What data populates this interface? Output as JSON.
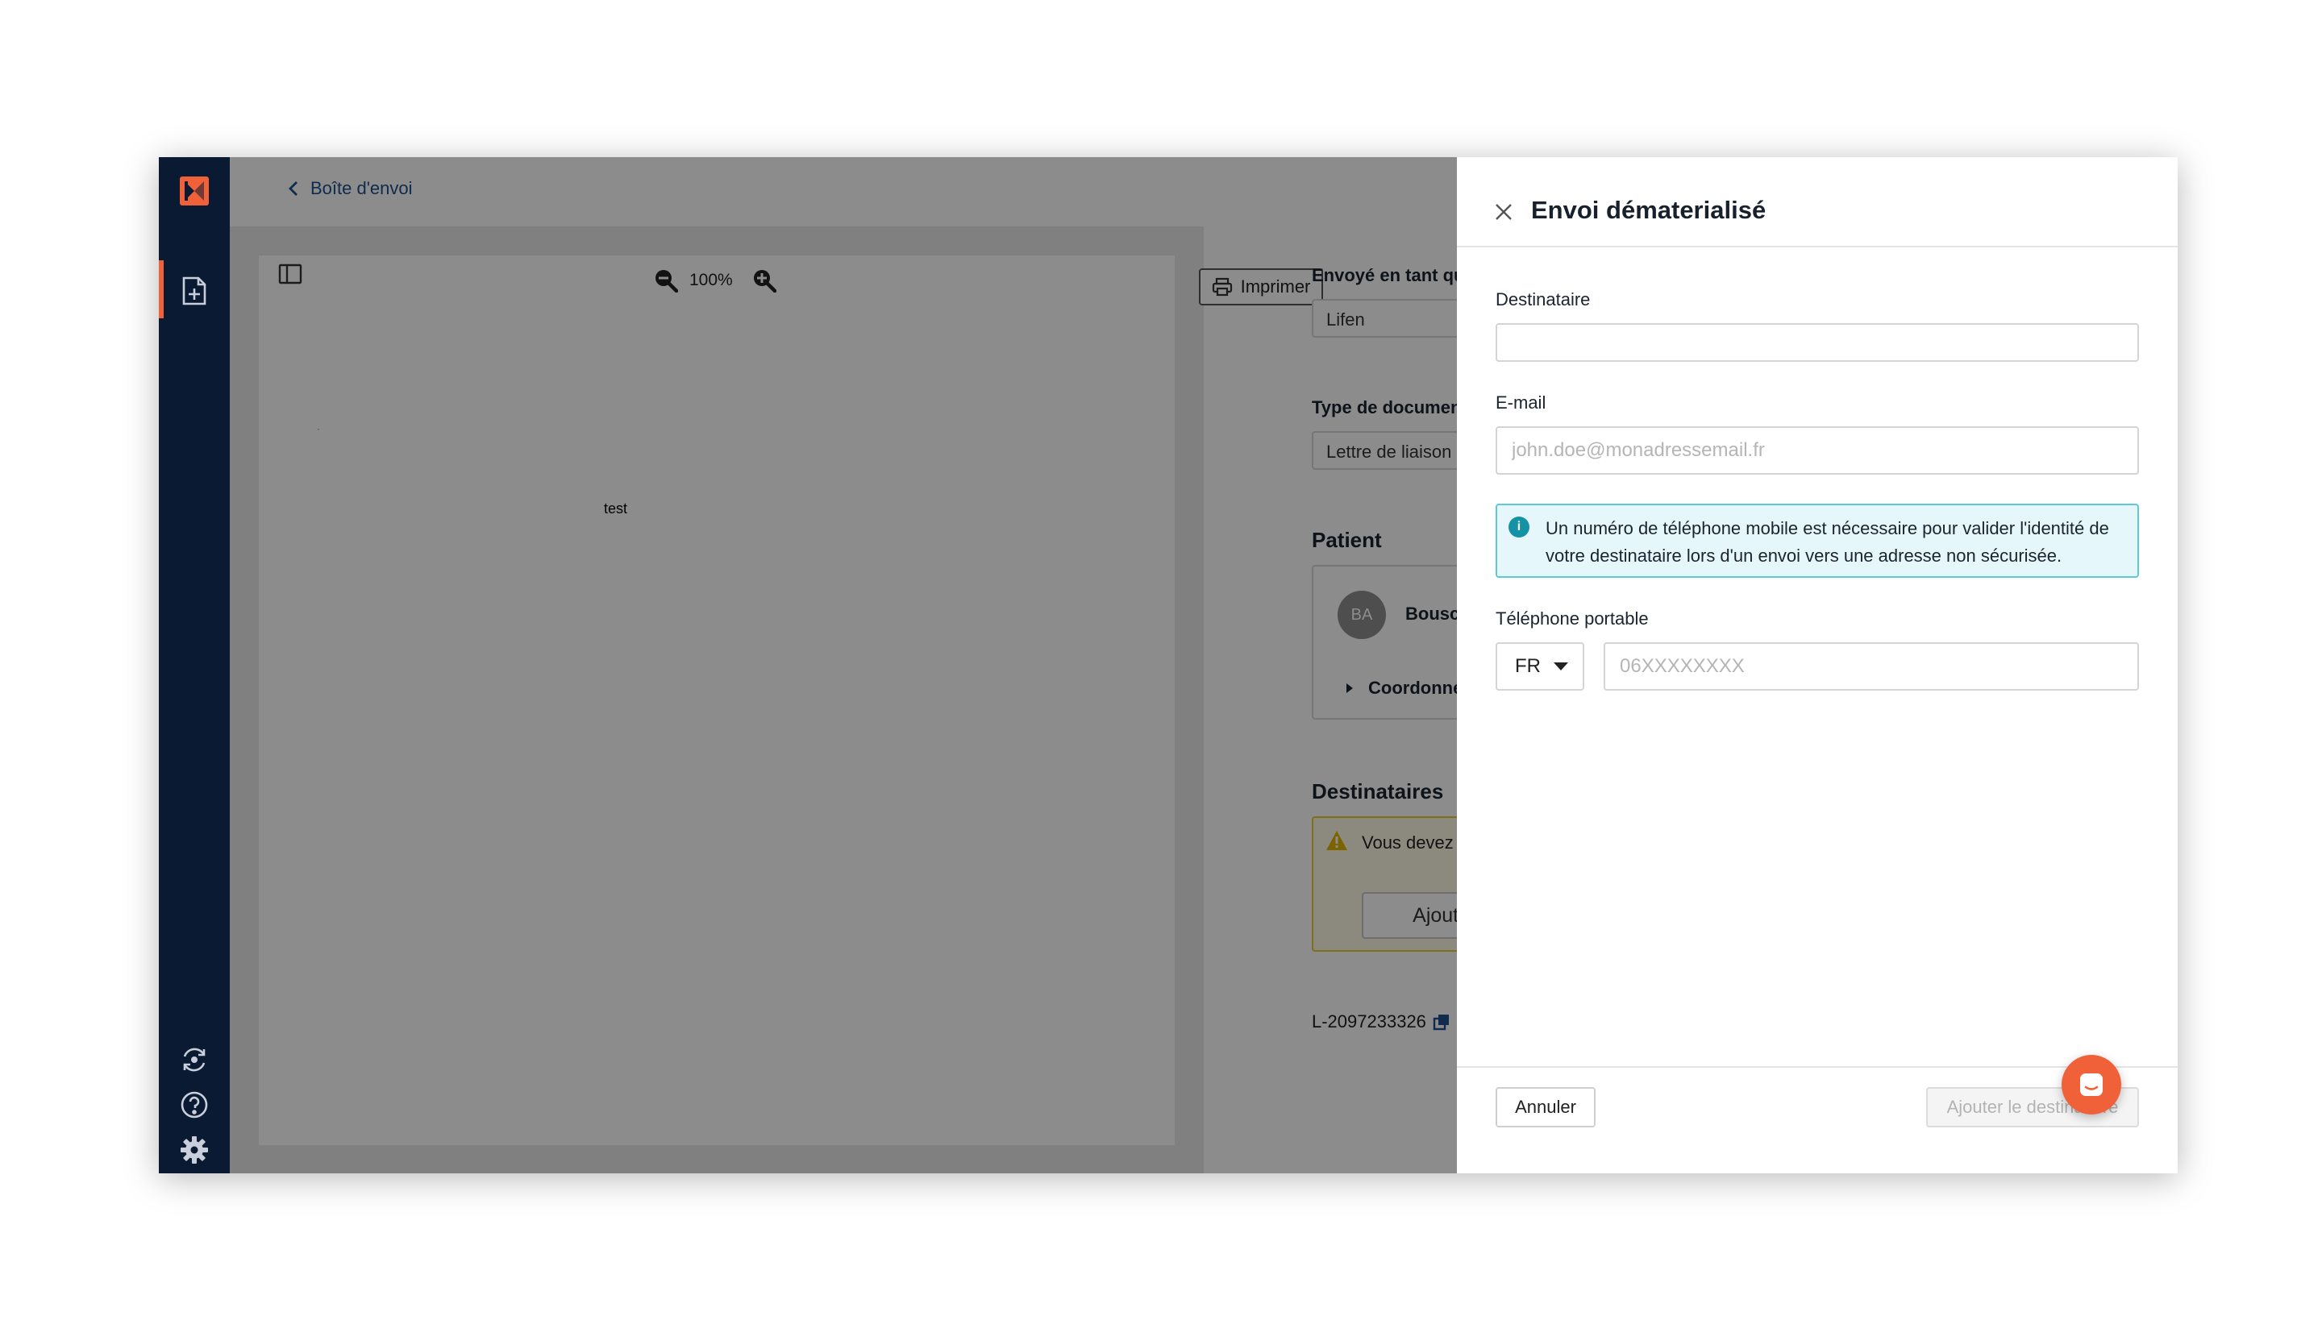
{
  "colors": {
    "sidebar_bg": "#0a1a33",
    "brand": "#f0613a",
    "link": "#1e4f8f",
    "info_bg": "#e5f7fa",
    "info_border": "#5ec8d8",
    "warning_border": "#e7c830"
  },
  "sidebar": {
    "items": [
      {
        "icon": "new-document-icon"
      },
      {
        "icon": "sync-icon"
      },
      {
        "icon": "help-icon"
      },
      {
        "icon": "gear-icon"
      }
    ]
  },
  "header": {
    "back_label": "Boîte d'envoi"
  },
  "viewer": {
    "zoom": "100%",
    "print_label": "Imprimer",
    "document_text": "test",
    "dot": "·"
  },
  "details": {
    "sent_as_label": "Envoyé en tant que",
    "sent_as_value": "Lifen",
    "doc_type_label": "Type de document",
    "doc_type_value": "Lettre de liaison (LDL)",
    "patient_title": "Patient",
    "patient_initials": "BA",
    "patient_name": "Bouscaud ALEX",
    "coordinates_label": "Coordonnées",
    "recipients_title": "Destinataires",
    "warning_text": "Vous devez renseigne",
    "add_recipient_label": "Ajouter un desti",
    "reference": "L-2097233326"
  },
  "drawer": {
    "title": "Envoi dématerialisé",
    "recipient_label": "Destinataire",
    "recipient_value": "",
    "email_label": "E-mail",
    "email_placeholder": "john.doe@monadressemail.fr",
    "info_message": "Un numéro de téléphone mobile est nécessaire pour valider l'identité de votre destinataire lors d'un envoi vers une adresse non sécurisée.",
    "phone_label": "Téléphone portable",
    "country_code": "FR",
    "phone_placeholder": "06XXXXXXXX",
    "cancel_label": "Annuler",
    "submit_label": "Ajouter le destinataire"
  }
}
